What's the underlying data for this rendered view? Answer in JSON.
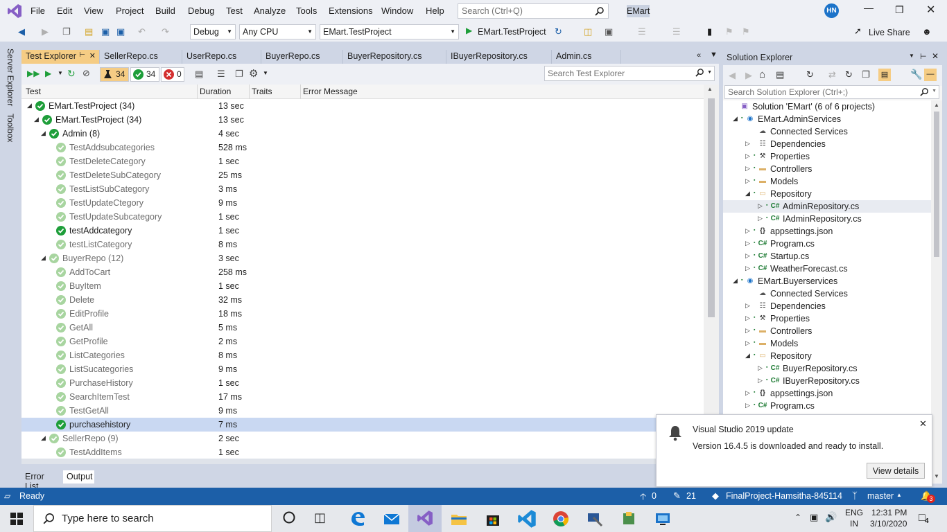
{
  "menu": [
    "File",
    "Edit",
    "View",
    "Project",
    "Build",
    "Debug",
    "Test",
    "Analyze",
    "Tools",
    "Extensions",
    "Window",
    "Help"
  ],
  "quick_search_placeholder": "Search (Ctrl+Q)",
  "solution_name": "EMart",
  "user_initials": "HN",
  "toolbar": {
    "config": "Debug",
    "platform": "Any CPU",
    "startup_project": "EMart.TestProject",
    "run_target": "EMart.TestProject",
    "live_share": "Live Share"
  },
  "side_tabs": [
    "Server Explorer",
    "Toolbox"
  ],
  "doc_tabs": [
    "Test Explorer",
    "SellerRepo.cs",
    "UserRepo.cs",
    "BuyerRepo.cs",
    "BuyerRepository.cs",
    "IBuyerRepository.cs",
    "Admin.cs"
  ],
  "test_explorer": {
    "counts": {
      "total": "34",
      "passed": "34",
      "failed": "0"
    },
    "search_placeholder": "Search Test Explorer",
    "columns": [
      "Test",
      "Duration",
      "Traits",
      "Error Message"
    ],
    "rows": [
      {
        "name": "EMart.TestProject (34)",
        "duration": "13 sec",
        "level": 0,
        "bold": true
      },
      {
        "name": "EMart.TestProject (34)",
        "duration": "13 sec",
        "level": 1,
        "bold": true
      },
      {
        "name": "Admin (8)",
        "duration": "4 sec",
        "level": 2,
        "bold": true
      },
      {
        "name": "TestAddsubcategories",
        "duration": "528 ms",
        "level": 3
      },
      {
        "name": "TestDeleteCategory",
        "duration": "1 sec",
        "level": 3
      },
      {
        "name": "TestDeleteSubCategory",
        "duration": "25 ms",
        "level": 3
      },
      {
        "name": "TestListSubCategory",
        "duration": "3 ms",
        "level": 3
      },
      {
        "name": "TestUpdateCtegory",
        "duration": "9 ms",
        "level": 3
      },
      {
        "name": "TestUpdateSubcategory",
        "duration": "1 sec",
        "level": 3
      },
      {
        "name": "testAddcategory",
        "duration": "1 sec",
        "level": 3,
        "bold": true
      },
      {
        "name": "testListCategory",
        "duration": "8 ms",
        "level": 3
      },
      {
        "name": "BuyerRepo (12)",
        "duration": "3 sec",
        "level": 2
      },
      {
        "name": "AddToCart",
        "duration": "258 ms",
        "level": 3
      },
      {
        "name": "BuyItem",
        "duration": "1 sec",
        "level": 3
      },
      {
        "name": "Delete",
        "duration": "32 ms",
        "level": 3
      },
      {
        "name": "EditProfile",
        "duration": "18 ms",
        "level": 3
      },
      {
        "name": "GetAll",
        "duration": "5 ms",
        "level": 3
      },
      {
        "name": "GetProfile",
        "duration": "2 ms",
        "level": 3
      },
      {
        "name": "ListCategories",
        "duration": "8 ms",
        "level": 3
      },
      {
        "name": "ListSucategories",
        "duration": "9 ms",
        "level": 3
      },
      {
        "name": "PurchaseHistory",
        "duration": "1 sec",
        "level": 3
      },
      {
        "name": "SearchItemTest",
        "duration": "17 ms",
        "level": 3
      },
      {
        "name": "TestGetAll",
        "duration": "9 ms",
        "level": 3
      },
      {
        "name": "purchasehistory",
        "duration": "7 ms",
        "level": 3,
        "bold": true,
        "selected": true
      },
      {
        "name": "SellerRepo (9)",
        "duration": "2 sec",
        "level": 2
      },
      {
        "name": "TestAddItems",
        "duration": "1 sec",
        "level": 3
      }
    ]
  },
  "bottom_tabs": [
    "Error List",
    "Output"
  ],
  "solution_explorer": {
    "title": "Solution Explorer",
    "search_placeholder": "Search Solution Explorer (Ctrl+;)",
    "items": [
      {
        "name": "Solution 'EMart' (6 of 6 projects)",
        "level": 0,
        "icon": "solution-icon"
      },
      {
        "name": "EMart.AdminServices",
        "level": 1,
        "icon": "web-project-icon",
        "expanded": true
      },
      {
        "name": "Connected Services",
        "level": 2,
        "icon": "cloud-icon"
      },
      {
        "name": "Dependencies",
        "level": 2,
        "icon": "dependencies-icon",
        "collapsed": true
      },
      {
        "name": "Properties",
        "level": 2,
        "icon": "wrench-icon",
        "collapsed": true
      },
      {
        "name": "Controllers",
        "level": 2,
        "icon": "folder-icon",
        "collapsed": true
      },
      {
        "name": "Models",
        "level": 2,
        "icon": "folder-icon",
        "collapsed": true
      },
      {
        "name": "Repository",
        "level": 2,
        "icon": "folder-open-icon",
        "expanded": true
      },
      {
        "name": "AdminRepository.cs",
        "level": 3,
        "icon": "csharp-file-icon",
        "collapsed": true,
        "highlight": true
      },
      {
        "name": "IAdminRepository.cs",
        "level": 3,
        "icon": "csharp-file-icon",
        "collapsed": true
      },
      {
        "name": "appsettings.json",
        "level": 2,
        "icon": "json-icon",
        "collapsed": true
      },
      {
        "name": "Program.cs",
        "level": 2,
        "icon": "csharp-file-icon",
        "collapsed": true
      },
      {
        "name": "Startup.cs",
        "level": 2,
        "icon": "csharp-file-icon",
        "collapsed": true
      },
      {
        "name": "WeatherForecast.cs",
        "level": 2,
        "icon": "csharp-file-icon",
        "collapsed": true
      },
      {
        "name": "EMart.Buyerservices",
        "level": 1,
        "icon": "web-project-icon",
        "expanded": true
      },
      {
        "name": "Connected Services",
        "level": 2,
        "icon": "cloud-icon"
      },
      {
        "name": "Dependencies",
        "level": 2,
        "icon": "dependencies-icon",
        "collapsed": true
      },
      {
        "name": "Properties",
        "level": 2,
        "icon": "wrench-icon",
        "collapsed": true
      },
      {
        "name": "Controllers",
        "level": 2,
        "icon": "folder-icon",
        "collapsed": true
      },
      {
        "name": "Models",
        "level": 2,
        "icon": "folder-icon",
        "collapsed": true
      },
      {
        "name": "Repository",
        "level": 2,
        "icon": "folder-open-icon",
        "expanded": true
      },
      {
        "name": "BuyerRepository.cs",
        "level": 3,
        "icon": "csharp-file-icon",
        "collapsed": true
      },
      {
        "name": "IBuyerRepository.cs",
        "level": 3,
        "icon": "csharp-file-icon",
        "collapsed": true
      },
      {
        "name": "appsettings.json",
        "level": 2,
        "icon": "json-icon",
        "collapsed": true
      },
      {
        "name": "Program.cs",
        "level": 2,
        "icon": "csharp-file-icon",
        "collapsed": true
      }
    ]
  },
  "notification": {
    "title": "Visual Studio 2019 update",
    "body": "Version 16.4.5 is downloaded and ready to install.",
    "action": "View details"
  },
  "status_bar": {
    "state": "Ready",
    "up_count": "0",
    "pending_changes": "21",
    "repo": "FinalProject-Hamsitha-845114",
    "branch": "master",
    "notifications": "3"
  },
  "taskbar": {
    "search_placeholder": "Type here to search",
    "lang": "ENG",
    "region": "IN",
    "time": "12:31 PM",
    "date": "3/10/2020",
    "notif_count": "4"
  },
  "colors": {
    "accent_tab": "#f5cc84",
    "status_bar": "#1c5fa8",
    "pass_green": "#1e9e3a",
    "fail_red": "#d32f2f",
    "selection": "#c9d8f2"
  }
}
